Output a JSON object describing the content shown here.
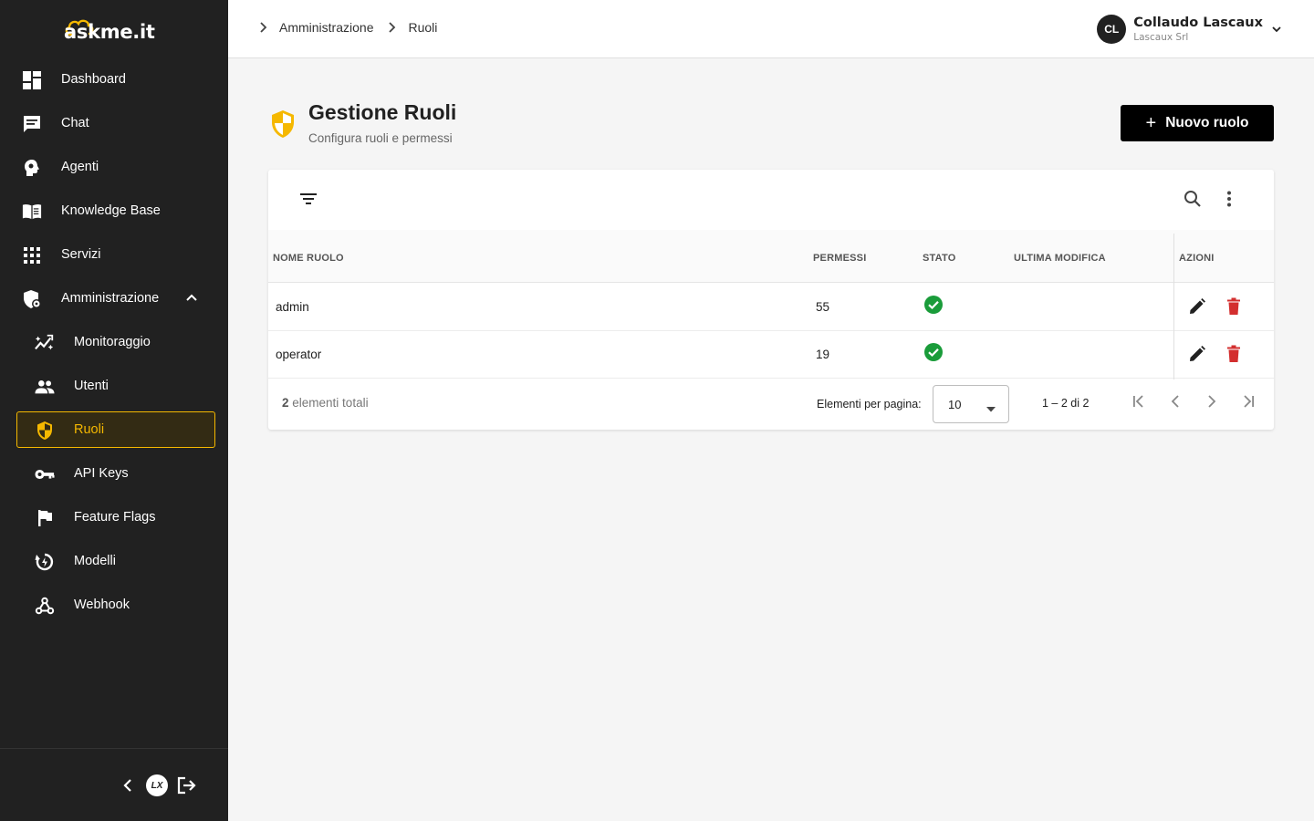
{
  "app": {
    "logo_text": "askme.it"
  },
  "sidebar": {
    "items": [
      {
        "label": "Dashboard",
        "icon": "dashboard-icon"
      },
      {
        "label": "Chat",
        "icon": "chat-icon"
      },
      {
        "label": "Agenti",
        "icon": "agent-head-icon"
      },
      {
        "label": "Knowledge Base",
        "icon": "book-icon"
      },
      {
        "label": "Servizi",
        "icon": "grid-icon"
      },
      {
        "label": "Amministrazione",
        "icon": "admin-shield-icon",
        "expanded": true
      }
    ],
    "subitems": [
      {
        "label": "Monitoraggio",
        "icon": "trend-icon"
      },
      {
        "label": "Utenti",
        "icon": "people-icon"
      },
      {
        "label": "Ruoli",
        "icon": "shield-icon",
        "active": true
      },
      {
        "label": "API Keys",
        "icon": "key-icon"
      },
      {
        "label": "Feature Flags",
        "icon": "flag-icon"
      },
      {
        "label": "Modelli",
        "icon": "model-icon"
      },
      {
        "label": "Webhook",
        "icon": "webhook-icon"
      }
    ],
    "footer": {
      "collapse_icon": "chevron-left-icon",
      "badge_text": "LX",
      "logout_icon": "logout-icon"
    }
  },
  "topbar": {
    "breadcrumb": [
      "Amministrazione",
      "Ruoli"
    ],
    "user": {
      "initials": "CL",
      "name": "Collaudo Lascaux",
      "org": "Lascaux Srl"
    }
  },
  "page": {
    "title": "Gestione Ruoli",
    "subtitle": "Configura ruoli e permessi",
    "new_button": "Nuovo ruolo",
    "new_button_icon": "+"
  },
  "table": {
    "columns": [
      "NOME RUOLO",
      "PERMESSI",
      "STATO",
      "ULTIMA MODIFICA",
      "AZIONI"
    ],
    "rows": [
      {
        "name": "admin",
        "permissions": "55",
        "status": "active",
        "last_modified": ""
      },
      {
        "name": "operator",
        "permissions": "19",
        "status": "active",
        "last_modified": ""
      }
    ],
    "total_count": "2",
    "total_label": "elementi totali",
    "per_page_label": "Elementi per pagina:",
    "per_page_value": "10",
    "range": "1 – 2 di 2"
  },
  "colors": {
    "sidebar_bg": "#212121",
    "accent": "#f5b800",
    "success": "#1a9c3a",
    "danger": "#d32f2f",
    "primary_button": "#000000"
  }
}
